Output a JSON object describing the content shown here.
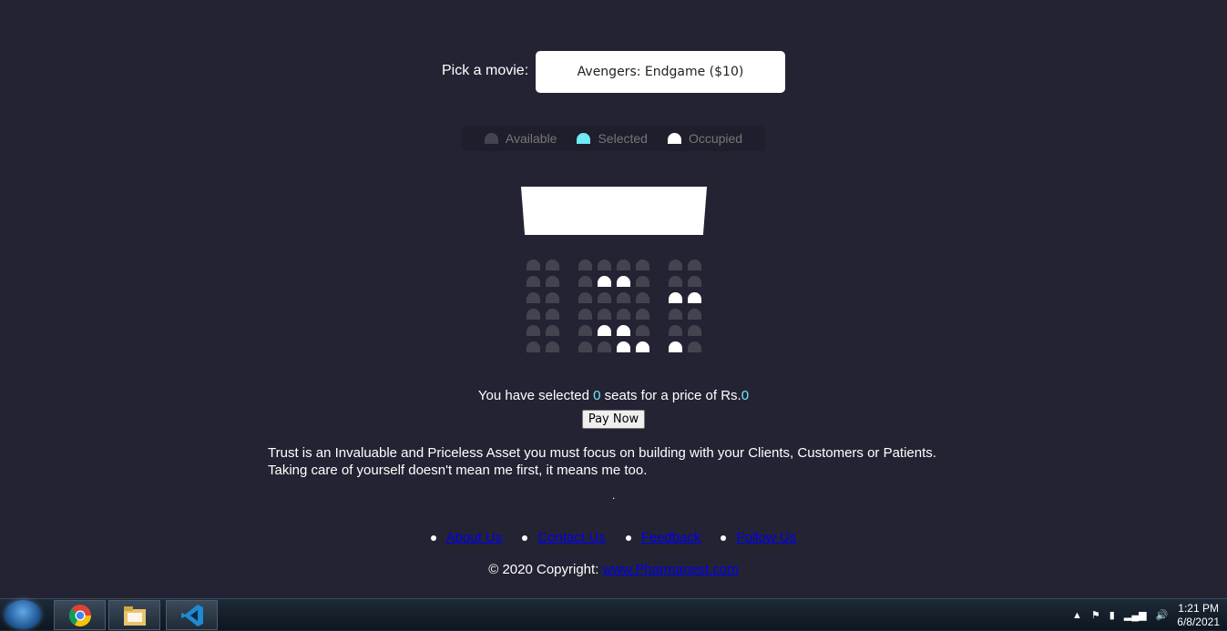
{
  "movie": {
    "label": "Pick a movie:",
    "selected": "Avengers: Endgame ($10)"
  },
  "legend": {
    "available": "Available",
    "selected": "Selected",
    "occupied": "Occupied"
  },
  "colors": {
    "background": "#242333",
    "seat_available": "#444451",
    "seat_selected": "#6feaf6",
    "seat_occupied": "#ffffff"
  },
  "seat_rows": [
    [
      "available",
      "available",
      "available",
      "available",
      "available",
      "available",
      "available",
      "available"
    ],
    [
      "available",
      "available",
      "available",
      "occupied",
      "occupied",
      "available",
      "available",
      "available"
    ],
    [
      "available",
      "available",
      "available",
      "available",
      "available",
      "available",
      "occupied",
      "occupied"
    ],
    [
      "available",
      "available",
      "available",
      "available",
      "available",
      "available",
      "available",
      "available"
    ],
    [
      "available",
      "available",
      "available",
      "occupied",
      "occupied",
      "available",
      "available",
      "available"
    ],
    [
      "available",
      "available",
      "available",
      "available",
      "occupied",
      "occupied",
      "occupied",
      "available"
    ]
  ],
  "summary": {
    "prefix": "You have selected ",
    "count": "0",
    "middle": " seats for a price of Rs.",
    "price": "0"
  },
  "pay_button": "Pay Now",
  "quote": {
    "line1": "Trust is an Invaluable and Priceless Asset you must focus on building with your Clients, Customers or Patients.",
    "line2": "Taking care of yourself doesn't mean me first, it means me too."
  },
  "dot": ".",
  "footer": {
    "links": [
      "About Us",
      "Contact Us",
      "Feedback",
      "Follow Us"
    ],
    "copyright_prefix": "© 2020 Copyright: ",
    "copyright_link": "www.Pharmanest.com"
  },
  "taskbar": {
    "apps": [
      "chrome-icon",
      "file-explorer-icon",
      "vscode-icon"
    ],
    "time": "1:21 PM",
    "date": "6/8/2021"
  }
}
